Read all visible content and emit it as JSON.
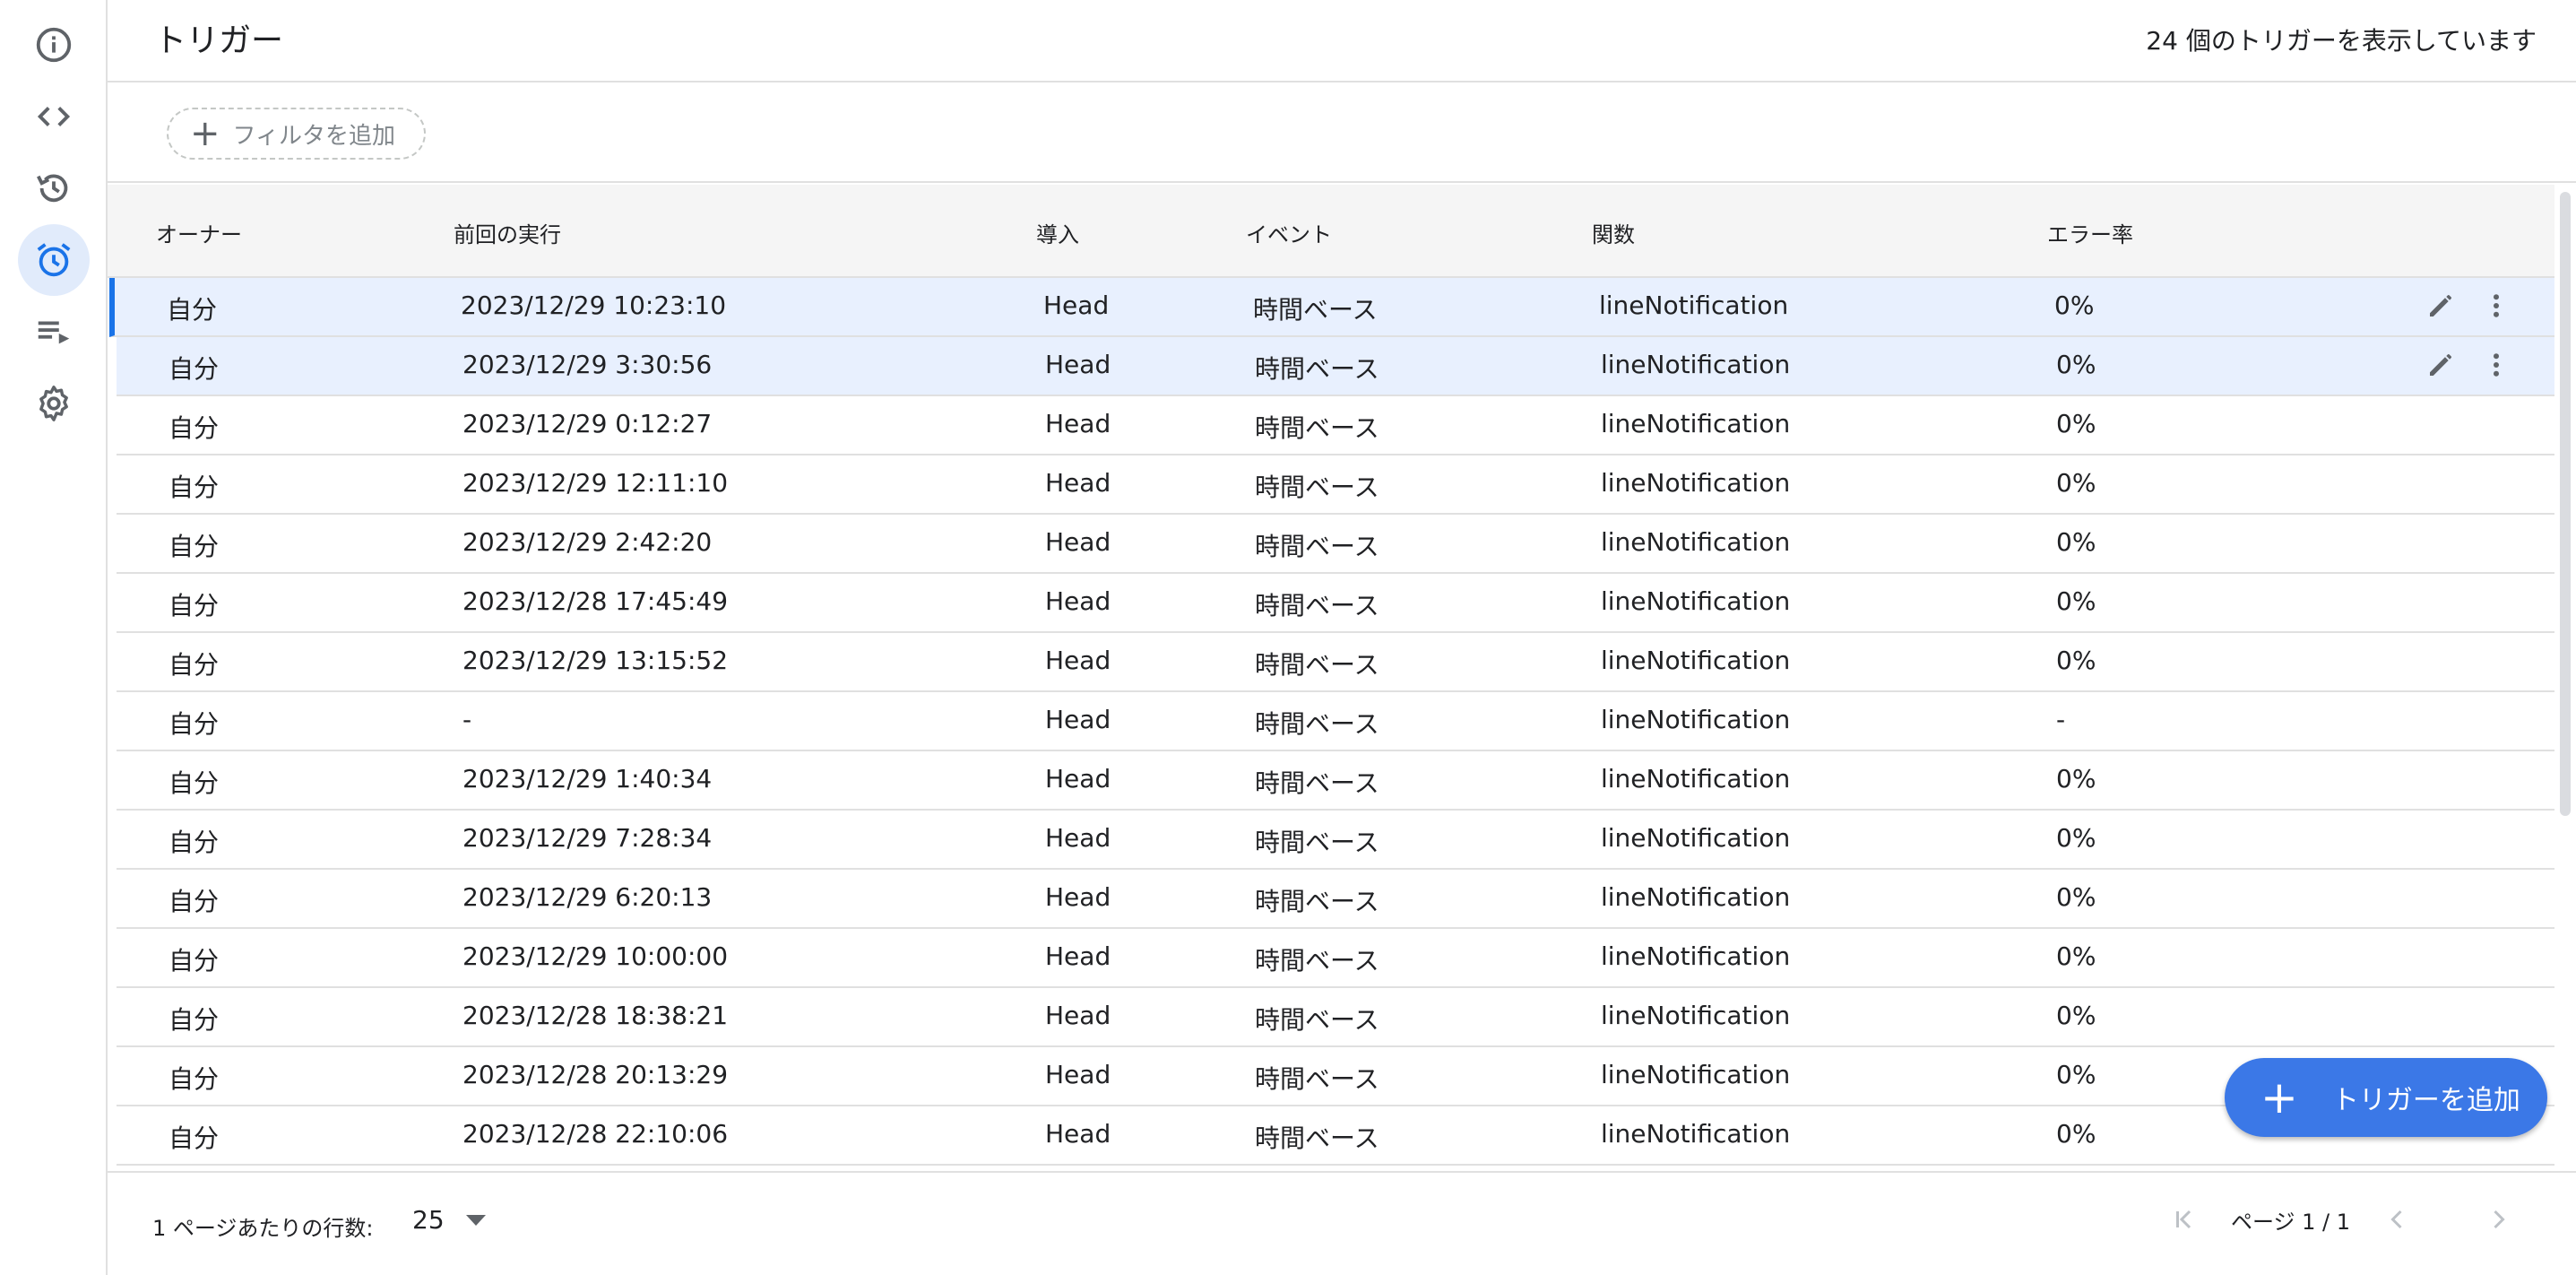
{
  "rail": {
    "items": [
      {
        "icon": "info-icon"
      },
      {
        "icon": "code-icon"
      },
      {
        "icon": "history-icon"
      },
      {
        "icon": "alarm-icon",
        "active": true
      },
      {
        "icon": "executions-icon"
      },
      {
        "icon": "gear-icon"
      }
    ]
  },
  "header": {
    "title": "トリガー",
    "count_text": "24 個のトリガーを表示しています"
  },
  "filter": {
    "add_label": "フィルタを追加"
  },
  "table": {
    "columns": [
      "オーナー",
      "前回の実行",
      "導入",
      "イベント",
      "関数",
      "エラー率"
    ],
    "rows": [
      [
        "自分",
        "2023/12/29 10:23:10",
        "Head",
        "時間ベース",
        "lineNotification",
        "0%"
      ],
      [
        "自分",
        "2023/12/29 3:30:56",
        "Head",
        "時間ベース",
        "lineNotification",
        "0%"
      ],
      [
        "自分",
        "2023/12/29 0:12:27",
        "Head",
        "時間ベース",
        "lineNotification",
        "0%"
      ],
      [
        "自分",
        "2023/12/29 12:11:10",
        "Head",
        "時間ベース",
        "lineNotification",
        "0%"
      ],
      [
        "自分",
        "2023/12/29 2:42:20",
        "Head",
        "時間ベース",
        "lineNotification",
        "0%"
      ],
      [
        "自分",
        "2023/12/28 17:45:49",
        "Head",
        "時間ベース",
        "lineNotification",
        "0%"
      ],
      [
        "自分",
        "2023/12/29 13:15:52",
        "Head",
        "時間ベース",
        "lineNotification",
        "0%"
      ],
      [
        "自分",
        "-",
        "Head",
        "時間ベース",
        "lineNotification",
        "-"
      ],
      [
        "自分",
        "2023/12/29 1:40:34",
        "Head",
        "時間ベース",
        "lineNotification",
        "0%"
      ],
      [
        "自分",
        "2023/12/29 7:28:34",
        "Head",
        "時間ベース",
        "lineNotification",
        "0%"
      ],
      [
        "自分",
        "2023/12/29 6:20:13",
        "Head",
        "時間ベース",
        "lineNotification",
        "0%"
      ],
      [
        "自分",
        "2023/12/29 10:00:00",
        "Head",
        "時間ベース",
        "lineNotification",
        "0%"
      ],
      [
        "自分",
        "2023/12/28 18:38:21",
        "Head",
        "時間ベース",
        "lineNotification",
        "0%"
      ],
      [
        "自分",
        "2023/12/28 20:13:29",
        "Head",
        "時間ベース",
        "lineNotification",
        "0%"
      ],
      [
        "自分",
        "2023/12/28 22:10:06",
        "Head",
        "時間ベース",
        "lineNotification",
        "0%"
      ]
    ]
  },
  "fab": {
    "label": "トリガーを追加"
  },
  "footer": {
    "rows_per_page_label": "1 ページあたりの行数:",
    "rows_per_page_value": "25",
    "page_info": "ページ 1 / 1"
  },
  "colors": {
    "accent": "#1a73e8",
    "fab": "#3b78e7",
    "selected_row": "#e8f0fe",
    "active_rail": "#e1ebfb"
  }
}
